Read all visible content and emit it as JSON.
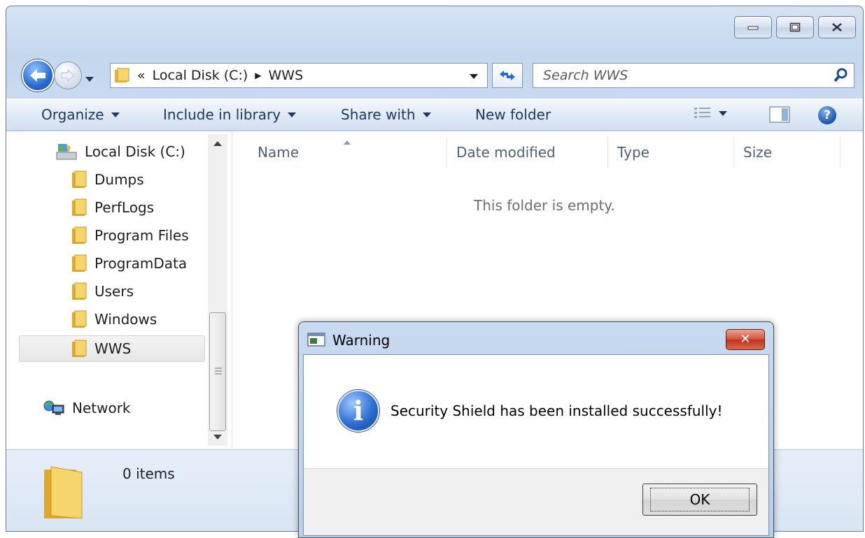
{
  "window": {
    "caption_buttons": [
      "minimize",
      "maximize",
      "close"
    ]
  },
  "address": {
    "overflow_chevron": "«",
    "crumbs": [
      "Local Disk (C:)",
      "WWS"
    ]
  },
  "search": {
    "placeholder": "Search WWS"
  },
  "commands": {
    "organize": "Organize",
    "include_in_library": "Include in library",
    "share_with": "Share with",
    "new_folder": "New folder",
    "help": "?"
  },
  "nav_pane": {
    "drive": "Local Disk (C:)",
    "folders": [
      "Dumps",
      "PerfLogs",
      "Program Files",
      "ProgramData",
      "Users",
      "Windows",
      "WWS"
    ],
    "selected": "WWS",
    "network": "Network"
  },
  "columns": [
    "Name",
    "Date modified",
    "Type",
    "Size"
  ],
  "empty_message": "This folder is empty.",
  "details": {
    "item_count": "0 items"
  },
  "dialog": {
    "title": "Warning",
    "close_label": "✕",
    "message": "Security Shield has been installed successfully!",
    "ok_label": "OK"
  },
  "colors": {
    "window_chrome": "#c4d7ee",
    "accent_blue": "#2a6bd1",
    "close_red": "#c0321c",
    "folder_yellow": "#f2c84b"
  }
}
